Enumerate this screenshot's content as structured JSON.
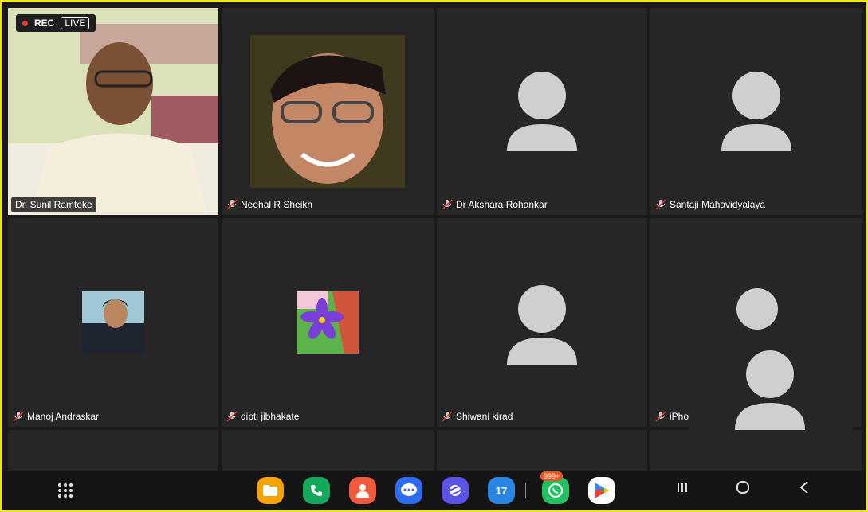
{
  "recording": {
    "rec_label": "REC",
    "live_label": "LIVE"
  },
  "participants": [
    {
      "name": "Dr. Sunil Ramteke",
      "muted": false,
      "video": true
    },
    {
      "name": "Neehal R Sheikh",
      "muted": true,
      "video": false
    },
    {
      "name": "Dr Akshara Rohankar",
      "muted": true,
      "video": false
    },
    {
      "name": "Santaji Mahavidyalaya",
      "muted": true,
      "video": false
    },
    {
      "name": "Manoj Andraskar",
      "muted": true,
      "video": false
    },
    {
      "name": "dipti jibhakate",
      "muted": true,
      "video": false
    },
    {
      "name": "Shiwani kirad",
      "muted": true,
      "video": false
    },
    {
      "name": "iPho",
      "muted": true,
      "video": false
    }
  ],
  "taskbar": {
    "apps": [
      {
        "name": "files-app-icon",
        "color": "#f4a300"
      },
      {
        "name": "phone-app-icon",
        "color": "#14a85a"
      },
      {
        "name": "contacts-app-icon",
        "color": "#ef5a3c"
      },
      {
        "name": "messages-app-icon",
        "color": "#2d6cf1"
      },
      {
        "name": "internet-app-icon",
        "color": "#5a54e0"
      },
      {
        "name": "calendar-app-icon",
        "color": "#2a86e0",
        "label": "17"
      },
      {
        "name": "whatsapp-app-icon",
        "color": "#25c064",
        "badge": "999+"
      },
      {
        "name": "play-store-app-icon",
        "color": "#ffffff"
      }
    ]
  }
}
